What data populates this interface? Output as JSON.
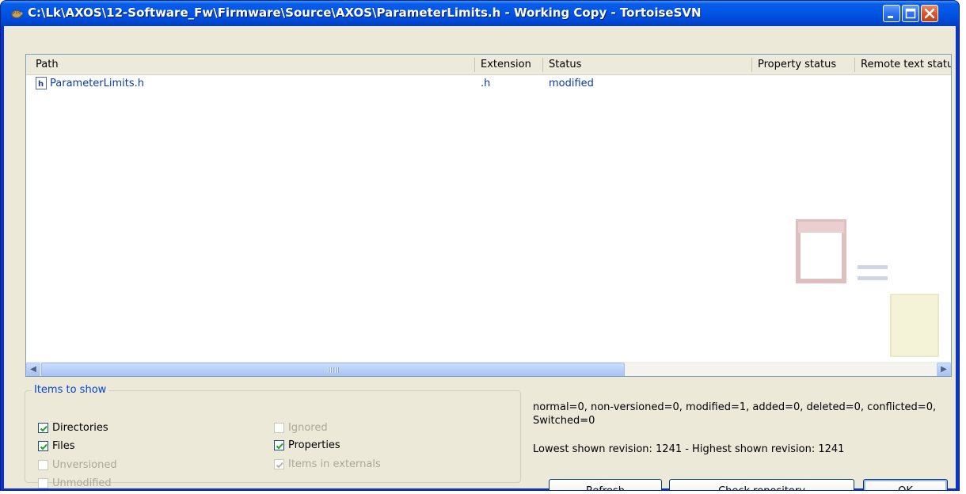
{
  "window": {
    "title": "C:\\Lk\\AXOS\\12-Software_Fw\\Firmware\\Source\\AXOS\\ParameterLimits.h - Working Copy - TortoiseSVN",
    "app_icon": "tortoise-icon"
  },
  "list": {
    "columns": [
      "Path",
      "Extension",
      "Status",
      "Property status",
      "Remote text statu"
    ],
    "rows": [
      {
        "path": "ParameterLimits.h",
        "extension": ".h",
        "status": "modified",
        "icon": "header-file-icon"
      }
    ]
  },
  "items_to_show": {
    "title": "Items to show",
    "options": [
      {
        "label": "Directories",
        "checked": true,
        "enabled": true
      },
      {
        "label": "Files",
        "checked": true,
        "enabled": true
      },
      {
        "label": "Unversioned",
        "checked": false,
        "enabled": false
      },
      {
        "label": "Unmodified",
        "checked": false,
        "enabled": false
      },
      {
        "label": "Ignored",
        "checked": false,
        "enabled": false
      },
      {
        "label": "Properties",
        "checked": true,
        "enabled": true
      },
      {
        "label": "Items in externals",
        "checked": true,
        "enabled": false
      }
    ]
  },
  "summary": {
    "counts": "normal=0, non-versioned=0, modified=1, added=0, deleted=0, conflicted=0, Switched=0",
    "revisions": "Lowest shown revision: 1241 - Highest shown revision: 1241"
  },
  "buttons": {
    "refresh": "Refresh",
    "check_repository": "Check repository",
    "ok": "OK"
  },
  "colors": {
    "titlebar": "#0055e5",
    "dialog_bg": "#ece9d8",
    "link_blue": "#0b3aa8",
    "group_title": "#0046d5"
  }
}
